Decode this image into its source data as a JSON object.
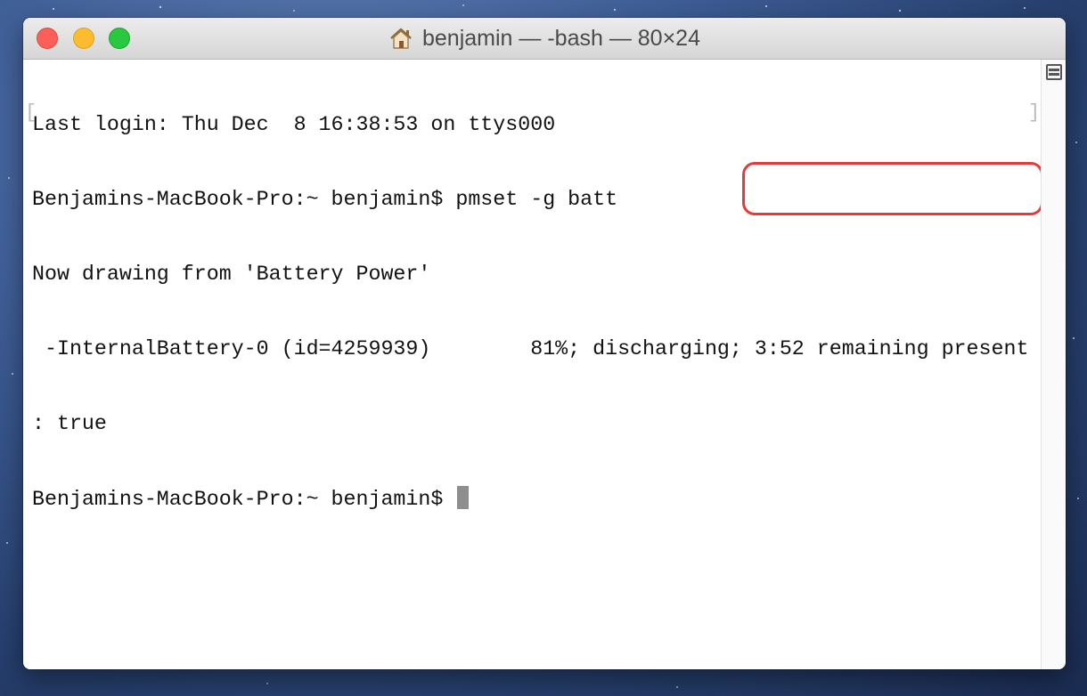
{
  "window": {
    "title": "benjamin — -bash — 80×24"
  },
  "terminal": {
    "lines": [
      "Last login: Thu Dec  8 16:38:53 on ttys000",
      "Benjamins-MacBook-Pro:~ benjamin$ pmset -g batt",
      "Now drawing from 'Battery Power'",
      " -InternalBattery-0 (id=4259939)        81%; discharging; 3:52 remaining present",
      ": true",
      "Benjamins-MacBook-Pro:~ benjamin$ "
    ],
    "mark_left": "[",
    "mark_right": "]"
  },
  "colors": {
    "highlight": "#e33b3b",
    "close": "#fc5f57",
    "minimize": "#fdbc2e",
    "maximize": "#28c840"
  },
  "icons": {
    "title_icon": "home-icon",
    "scroll_icon": "split-pane-icon"
  }
}
